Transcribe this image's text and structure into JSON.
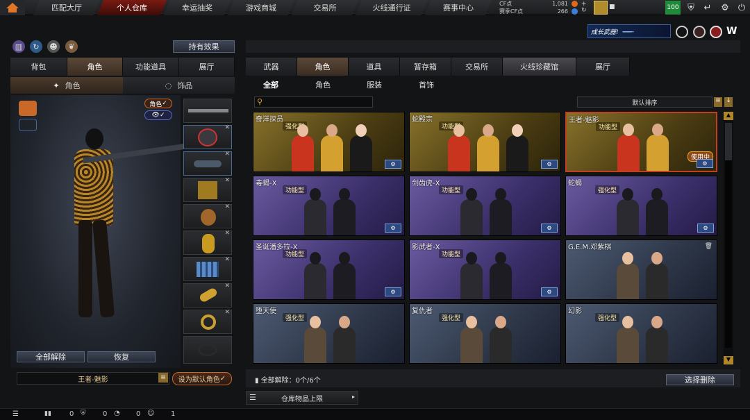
{
  "nav": {
    "tabs": [
      {
        "label": "匹配大厅"
      },
      {
        "label": "个人仓库"
      },
      {
        "label": "幸运抽奖"
      },
      {
        "label": "游戏商城"
      },
      {
        "label": "交易所"
      },
      {
        "label": "火线通行证"
      },
      {
        "label": "赛事中心"
      }
    ],
    "active_index": 1
  },
  "currency": {
    "cf_label": "CF点",
    "cf_value": "1,081",
    "season_label": "赛季CF点",
    "season_value": "266",
    "level": "100"
  },
  "banner": {
    "text": "成长武器!"
  },
  "left": {
    "effect_button": "持有效果",
    "tabs": [
      {
        "label": "背包"
      },
      {
        "label": "角色"
      },
      {
        "label": "功能道具"
      },
      {
        "label": "展厅"
      }
    ],
    "subtabs": [
      {
        "label": "角色"
      },
      {
        "label": "饰品"
      }
    ],
    "char_toggle": "角色",
    "unequip_all": "全部解除",
    "restore": "恢复",
    "current_character": "王者-魅影",
    "set_default": "设为默认角色"
  },
  "right": {
    "tabs": [
      {
        "label": "武器"
      },
      {
        "label": "角色"
      },
      {
        "label": "道具"
      },
      {
        "label": "暂存箱"
      },
      {
        "label": "交易所"
      },
      {
        "label": "火线珍藏馆"
      },
      {
        "label": "展厅"
      }
    ],
    "filters": [
      {
        "label": "全部"
      },
      {
        "label": "角色"
      },
      {
        "label": "服装"
      },
      {
        "label": "首饰"
      }
    ],
    "search_placeholder": "",
    "sort": "默认排序",
    "cards": [
      {
        "name": "奇洋探员",
        "badge": "强化型",
        "theme": "gold",
        "figs": 3
      },
      {
        "name": "蛇殿宗",
        "badge": "功能型",
        "theme": "gold",
        "figs": 3
      },
      {
        "name": "王者-魅影",
        "badge": "功能型",
        "theme": "gold",
        "figs": 2,
        "status": "使用中",
        "selected": true
      },
      {
        "name": "毒蝎-X",
        "badge": "功能型",
        "theme": "purple",
        "figs": 2
      },
      {
        "name": "剑齿虎-X",
        "badge": "功能型",
        "theme": "purple",
        "figs": 2
      },
      {
        "name": "蛇蝎",
        "badge": "强化型",
        "theme": "purple",
        "figs": 2
      },
      {
        "name": "圣诞潘多拉-X",
        "badge": "功能型",
        "theme": "purple",
        "figs": 2
      },
      {
        "name": "影武者-X",
        "badge": "功能型",
        "theme": "purple",
        "figs": 2
      },
      {
        "name": "G.E.M.邓紫棋",
        "badge": "",
        "theme": "blue",
        "figs": 2
      },
      {
        "name": "堕天使",
        "badge": "强化型",
        "theme": "blue",
        "figs": 2
      },
      {
        "name": "复仇者",
        "badge": "强化型",
        "theme": "blue",
        "figs": 2
      },
      {
        "name": "幻影",
        "badge": "强化型",
        "theme": "blue",
        "figs": 2
      }
    ],
    "unequip_status": "全部解除：0个/6个",
    "select_delete": "选择删除",
    "warehouse_limit": "仓库物品上限"
  },
  "bottom": {
    "counts": [
      "0",
      "0",
      "0",
      "1"
    ]
  }
}
